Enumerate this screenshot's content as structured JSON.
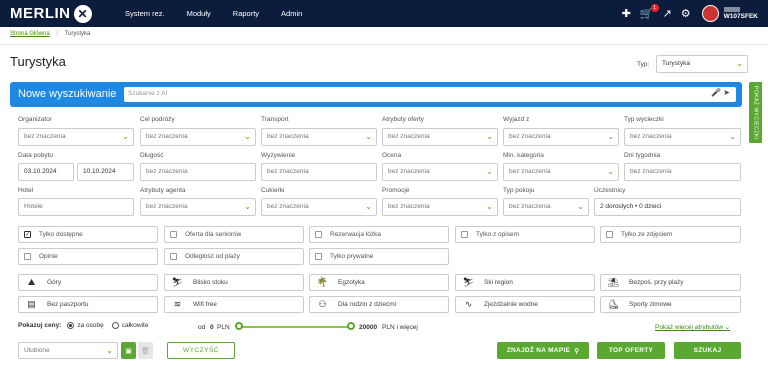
{
  "header": {
    "logo": "MERLIN",
    "nav": [
      "System rez.",
      "Moduły",
      "Raporty",
      "Admin"
    ],
    "cart_count": "1",
    "user_code": "W107SFEK"
  },
  "breadcrumb": {
    "home": "Strona Główna",
    "separator": "/",
    "current": "Turystyka"
  },
  "page": {
    "title": "Turystyka",
    "typ_label": "Typ:",
    "typ_value": "Turystyka"
  },
  "search": {
    "title": "Nowe wyszukiwanie",
    "placeholder": "Szukanie z AI"
  },
  "side_tab": "POKAŻ WYCIECZKI",
  "filters_row1": [
    {
      "label": "Organizator",
      "value": "bez znaczenia"
    },
    {
      "label": "Cel podróży",
      "value": "bez znaczenia"
    },
    {
      "label": "Transport",
      "value": "bez znaczenia"
    },
    {
      "label": "Atrybuty oferty",
      "value": "bez znaczenia"
    },
    {
      "label": "Wyjazd z",
      "value": "bez znaczenia"
    },
    {
      "label": "Typ wycieczki",
      "value": "bez znaczenia"
    }
  ],
  "filters_row2": {
    "data_pobytu": {
      "label": "Data pobytu",
      "from": "03.10.2024",
      "to": "10.10.2024"
    },
    "dlugosc": {
      "label": "Długość",
      "value": "bez znaczenia"
    },
    "wyzywienie": {
      "label": "Wyżywienie",
      "value": "bez znaczenia"
    },
    "ocena": {
      "label": "Ocena",
      "value": "bez znaczenia"
    },
    "min_kategoria": {
      "label": "Min. kategoria",
      "value": "bez znaczenia"
    },
    "dni_tygodnia": {
      "label": "Dni tygodnia",
      "value": "bez znaczenia"
    }
  },
  "filters_row3": {
    "hotel": {
      "label": "Hotel",
      "placeholder": "Hotele"
    },
    "atrybuty_agenta": {
      "label": "Atrybuty agenta",
      "value": "bez znaczenia"
    },
    "cukierki": {
      "label": "Cukierki",
      "value": "bez znaczenia"
    },
    "promocje": {
      "label": "Promocje",
      "value": "bez znaczenia"
    },
    "typ_pokoju": {
      "label": "Typ pokoju",
      "value": "bez znaczenia"
    },
    "uczestnicy": {
      "label": "Uczestnicy",
      "value": "2 dorosłych • 0 dzieci"
    }
  },
  "checkboxes": [
    {
      "label": "Tylko dostępne",
      "checked": true
    },
    {
      "label": "Oferta dla seniorów",
      "checked": false
    },
    {
      "label": "Rezerwacja łóżka",
      "checked": false
    },
    {
      "label": "Tylko z opisem",
      "checked": false
    },
    {
      "label": "Tylko ze zdjęciem",
      "checked": false
    },
    {
      "label": "Opinie",
      "checked": false
    },
    {
      "label": "Odległość od plaży",
      "checked": false
    },
    {
      "label": "Tylko prywatne",
      "checked": false
    }
  ],
  "attributes": [
    {
      "label": "Góry",
      "icon": "mountain-icon",
      "glyph": "⛰"
    },
    {
      "label": "Blisko stoku",
      "icon": "ski-lift-icon",
      "glyph": "⛷"
    },
    {
      "label": "Egzotyka",
      "icon": "palm-icon",
      "glyph": "🌴"
    },
    {
      "label": "Ski region",
      "icon": "skier-icon",
      "glyph": "⛷"
    },
    {
      "label": "Bezpoś. przy plaży",
      "icon": "beach-icon",
      "glyph": "⛱"
    },
    {
      "label": "Bez paszportu",
      "icon": "passport-icon",
      "glyph": "▤"
    },
    {
      "label": "Wifi free",
      "icon": "wifi-icon",
      "glyph": "≋"
    },
    {
      "label": "Dla rodzin z dziećmi",
      "icon": "family-icon",
      "glyph": "⚇"
    },
    {
      "label": "Zjeżdżalnie wodne",
      "icon": "waterslide-icon",
      "glyph": "∿"
    },
    {
      "label": "Sporty zimowe",
      "icon": "winter-sports-icon",
      "glyph": "⛸"
    }
  ],
  "prices": {
    "label": "Pokazuj ceny:",
    "per_person": "za osobę",
    "total": "całkowite",
    "from_prefix": "od",
    "min": "0",
    "currency": "PLN",
    "max": "20000",
    "suffix": "PLN i więcej",
    "more_attributes": "Pokaż więcej atrybutów"
  },
  "actions": {
    "favourites_placeholder": "Ulubione",
    "clear": "WYCZYŚĆ",
    "map": "ZNAJDŹ NA MAPIE",
    "top": "TOP OFERTY",
    "search": "SZUKAJ"
  },
  "colors": {
    "navy": "#0c1c3d",
    "blue": "#1e88e5",
    "green": "#5aa832"
  }
}
